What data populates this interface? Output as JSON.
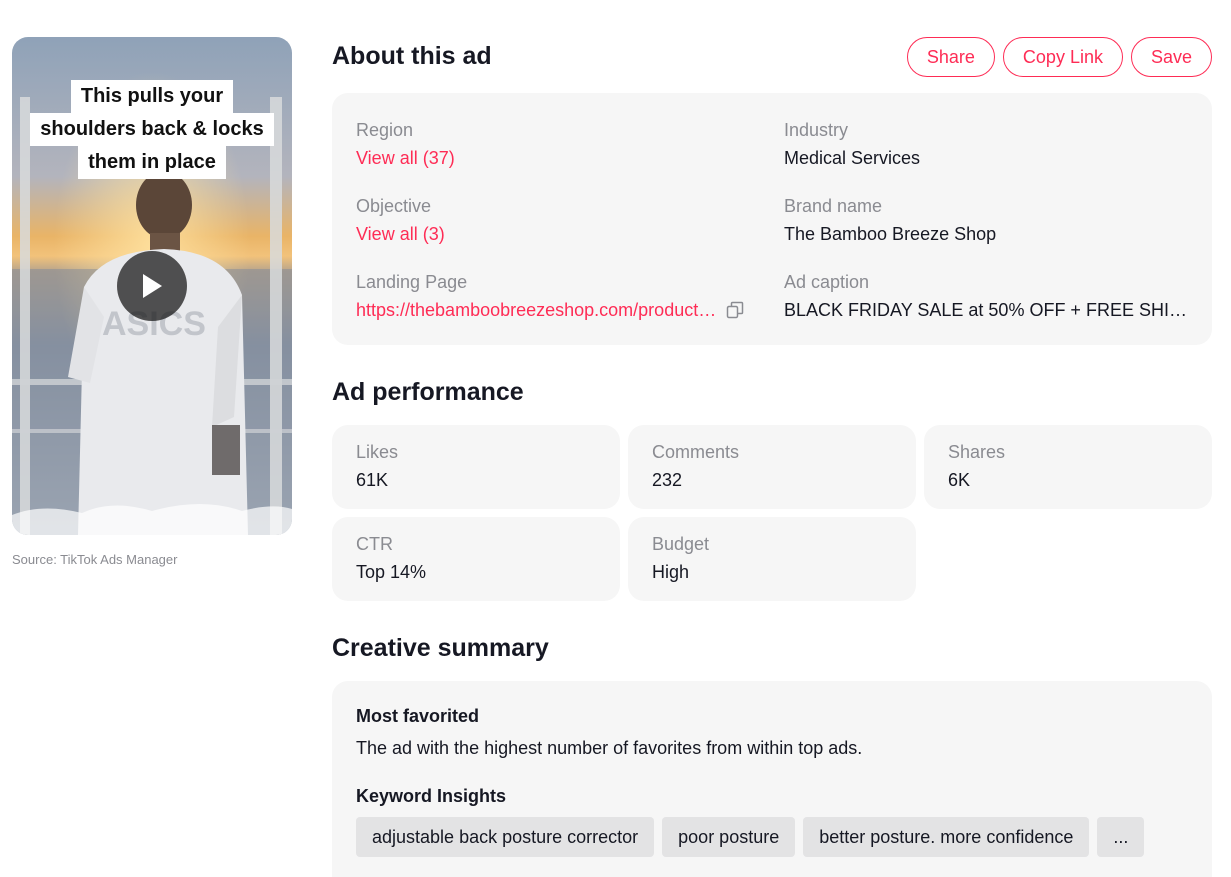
{
  "video": {
    "caption_lines": [
      "This pulls your",
      "shoulders back & locks",
      "them in place"
    ],
    "play_icon": "play-icon",
    "source": "Source: TikTok Ads Manager"
  },
  "about": {
    "title": "About this ad",
    "actions": {
      "share": "Share",
      "copy_link": "Copy Link",
      "save": "Save"
    },
    "region_label": "Region",
    "region_value": "View all (37)",
    "industry_label": "Industry",
    "industry_value": "Medical Services",
    "objective_label": "Objective",
    "objective_value": "View all (3)",
    "brand_label": "Brand name",
    "brand_value": "The Bamboo Breeze Shop",
    "landing_label": "Landing Page",
    "landing_value": "https://thebamboobreezeshop.com/product…",
    "landing_icon": "copy-icon",
    "caption_label": "Ad caption",
    "caption_value": "BLACK FRIDAY SALE at 50% OFF + FREE SHIP…"
  },
  "performance": {
    "title": "Ad performance",
    "metrics": [
      {
        "label": "Likes",
        "value": "61K"
      },
      {
        "label": "Comments",
        "value": "232"
      },
      {
        "label": "Shares",
        "value": "6K"
      },
      {
        "label": "CTR",
        "value": "Top 14%"
      },
      {
        "label": "Budget",
        "value": "High"
      }
    ]
  },
  "summary": {
    "title": "Creative summary",
    "favorited_heading": "Most favorited",
    "favorited_text": "The ad with the highest number of favorites from within top ads.",
    "keywords_heading": "Keyword Insights",
    "keywords": [
      "adjustable back posture corrector",
      "poor posture",
      "better posture. more confidence",
      "..."
    ]
  },
  "colors": {
    "accent": "#fe2c55",
    "card_bg": "#f6f6f6",
    "chip_bg": "#e3e3e4"
  }
}
